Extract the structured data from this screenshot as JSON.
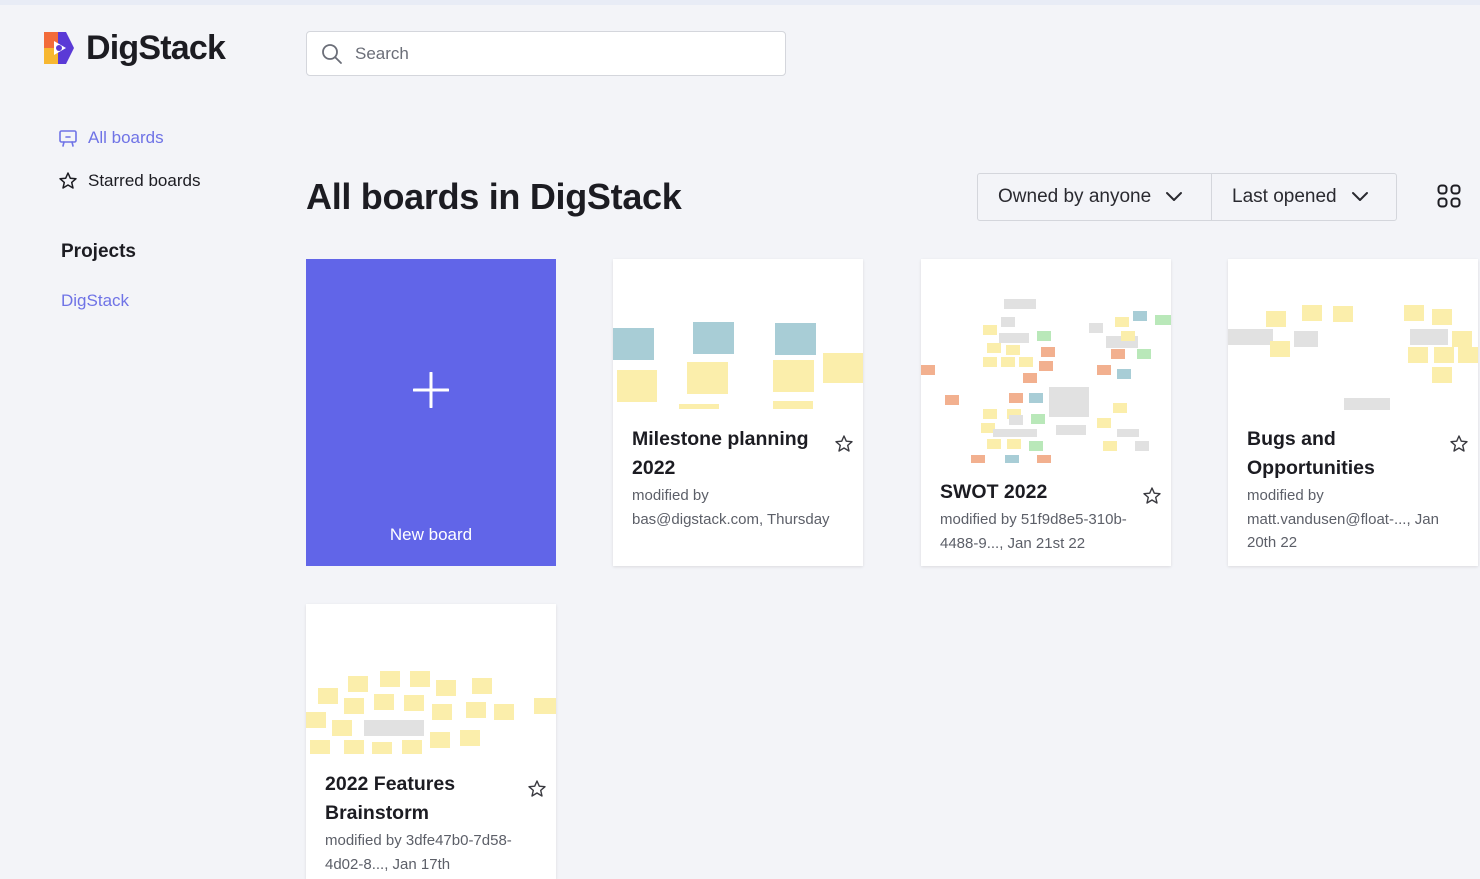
{
  "app": {
    "name": "DigStack"
  },
  "search": {
    "placeholder": "Search",
    "value": ""
  },
  "sidebar": {
    "nav": [
      {
        "label": "All boards",
        "icon": "board-icon",
        "active": true
      },
      {
        "label": "Starred boards",
        "icon": "star-icon",
        "active": false
      }
    ],
    "projects_heading": "Projects",
    "projects": [
      {
        "label": "DigStack"
      }
    ]
  },
  "main": {
    "title": "All boards in DigStack",
    "filters": {
      "owner": {
        "selected": "Owned by anyone"
      },
      "sort": {
        "selected": "Last opened"
      }
    },
    "view_toggle_icon": "grid-icon",
    "new_board_label": "New board",
    "boards": [
      {
        "title": "Milestone planning 2022",
        "meta": "modified by bas@digstack.com, Thursday",
        "starred": false
      },
      {
        "title": "SWOT 2022",
        "meta": "modified by 51f9d8e5-310b-4488-9..., Jan 21st 22",
        "starred": false
      },
      {
        "title": "Bugs and Opportunities",
        "meta": "modified by matt.vandusen@float-..., Jan 20th 22",
        "starred": false
      },
      {
        "title": "2022 Features Brainstorm",
        "meta": "modified by 3dfe47b0-7d58-4d02-8..., Jan 17th",
        "starred": false
      }
    ]
  },
  "colors": {
    "accent": "#6165e8",
    "link": "#6f73e6",
    "background": "#f3f4f8",
    "sticky_yellow": "#fbeeab",
    "sticky_blue": "#a8cdd6",
    "sticky_orange": "#f2b08f",
    "sticky_green": "#b9e8b9",
    "sticky_gray": "#e1e1e1"
  }
}
